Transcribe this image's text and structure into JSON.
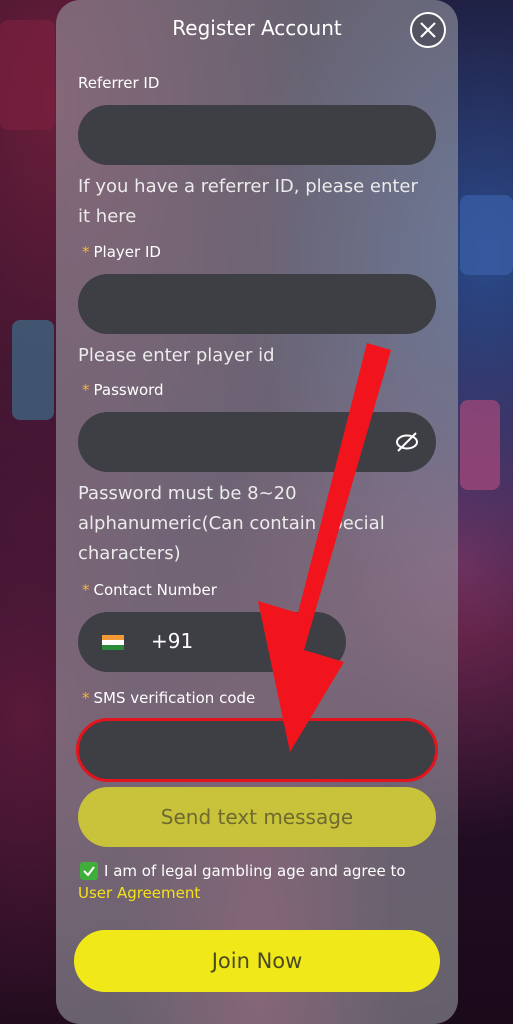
{
  "dialog": {
    "title": "Register Account"
  },
  "referrer": {
    "label": "Referrer ID",
    "hint": "If you have a referrer ID, please enter it here"
  },
  "player": {
    "required": "*",
    "label": "Player ID",
    "hint": "Please enter player id"
  },
  "password": {
    "required": "*",
    "label": "Password",
    "hint": "Password must be 8~20 alphanumeric(Can contain special characters)"
  },
  "contact": {
    "required": "*",
    "label": "Contact Number",
    "country_code": "+91"
  },
  "sms": {
    "required": "*",
    "label": "SMS verification code",
    "send_label": "Send text message"
  },
  "agreement": {
    "text": "I am of legal gambling age and agree to",
    "link": "User Agreement"
  },
  "join": {
    "label": "Join Now"
  },
  "colors": {
    "accent_yellow": "#f1e81a",
    "send_button": "#c8c33a",
    "highlight_red": "#e3141b",
    "checkbox_green": "#3fae3a"
  },
  "icons": [
    "close-icon",
    "eye-off-icon",
    "india-flag-icon",
    "check-icon",
    "red-arrow-annotation"
  ]
}
